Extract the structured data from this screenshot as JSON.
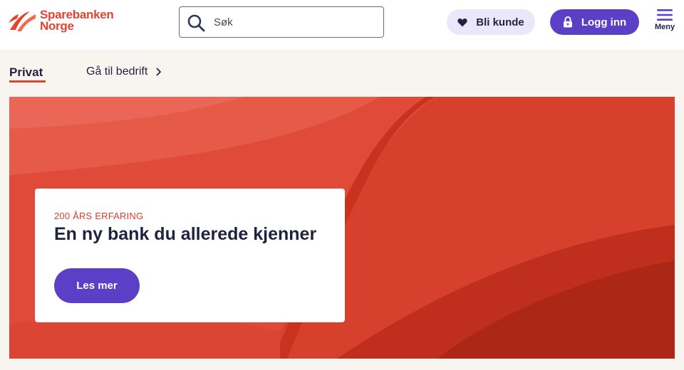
{
  "brand": {
    "line1": "Sparebanken",
    "line2": "Norge",
    "color": "#e2442f"
  },
  "search": {
    "placeholder": "Søk",
    "value": "",
    "icon": "search-icon"
  },
  "header_actions": {
    "bli_kunde_label": "Bli kunde",
    "bli_kunde_icon": "heart-icon",
    "logg_inn_label": "Logg inn",
    "logg_inn_icon": "lock-icon",
    "menu_label": "Meny",
    "menu_icon": "hamburger-icon"
  },
  "subnav": {
    "active_tab": "Privat",
    "bedrift_link": "Gå til bedrift",
    "bedrift_icon": "chevron-right-icon"
  },
  "hero": {
    "eyebrow": "200 ÅRS ERFARING",
    "title": "En ny bank du allerede kjenner",
    "cta_label": "Les mer"
  },
  "colors": {
    "accent": "#5b3fc7",
    "accent_light": "#ebe7fb",
    "brand_red": "#e2442f",
    "ink": "#1f2340",
    "sand": "#f8f5f0"
  }
}
